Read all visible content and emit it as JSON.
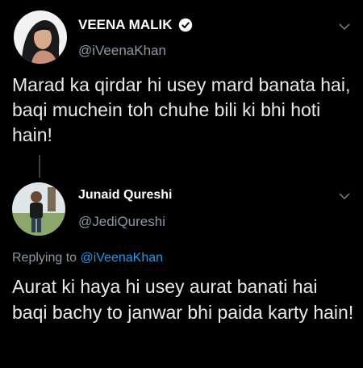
{
  "tweets": [
    {
      "author_name": "VEENA MALIK",
      "handle": "@iVeenaKhan",
      "verified": true,
      "text": "Marad ka qirdar hi usey mard banata hai, baqi muchein toh chuhe bili ki bhi hoti hain!"
    },
    {
      "author_name": "Junaid Qureshi",
      "handle": "@JediQureshi",
      "verified": false,
      "reply_prefix": "Replying to ",
      "reply_to": "@iVeenaKhan",
      "text": "Aurat ki haya hi usey aurat banati hai baqi bachy to janwar bhi paida karty hain!"
    }
  ],
  "icons": {
    "verified": "verified-badge-icon",
    "more": "chevron-down-icon"
  },
  "colors": {
    "background": "#000000",
    "name": "#ffffff",
    "secondary": "#8b98a5",
    "link": "#1d9bf0"
  }
}
